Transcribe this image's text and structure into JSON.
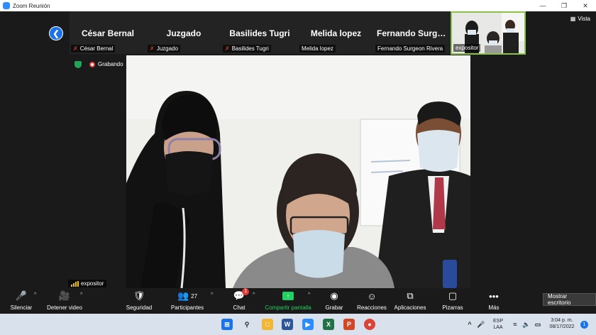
{
  "window": {
    "title": "Zoom Reunión"
  },
  "gallery": {
    "tiles": [
      {
        "big_name": "César Bernal",
        "small_name": "César Bernal",
        "muted": true
      },
      {
        "big_name": "Juzgado",
        "small_name": "Juzgado",
        "muted": true
      },
      {
        "big_name": "Basilides Tugri",
        "small_name": "Basilides Tugri",
        "muted": true
      },
      {
        "big_name": "Melida lopez",
        "small_name": "Melida lopez",
        "muted": false
      },
      {
        "big_name": "Fernando   Surge...",
        "small_name": "Fernando Surgeon Rivera",
        "muted": false
      }
    ],
    "video_tile_name": "expositor",
    "view_label": "Vista"
  },
  "status": {
    "recording_label": "Grabando"
  },
  "main_speaker": {
    "name": "expositor"
  },
  "toolbar": {
    "mute_label": "Silenciar",
    "video_label": "Detener video",
    "security_label": "Seguridad",
    "participants_label": "Participantes",
    "participants_count": "27",
    "chat_label": "Chat",
    "chat_badge": "1",
    "share_label": "Compartir pantalla",
    "record_label": "Grabar",
    "reactions_label": "Reacciones",
    "apps_label": "Aplicaciones",
    "whiteboards_label": "Pizarras",
    "more_label": "Más",
    "show_desktop_label": "Mostrar escritorio"
  },
  "taskbar": {
    "lang_line1": "ESP",
    "lang_line2": "LAA",
    "time": "3:04 p. m.",
    "date": "08/17/2022",
    "notification_count": "1"
  },
  "colors": {
    "accent_green": "#23d160",
    "brand_blue": "#2d8cff",
    "record_red": "#e53935"
  }
}
